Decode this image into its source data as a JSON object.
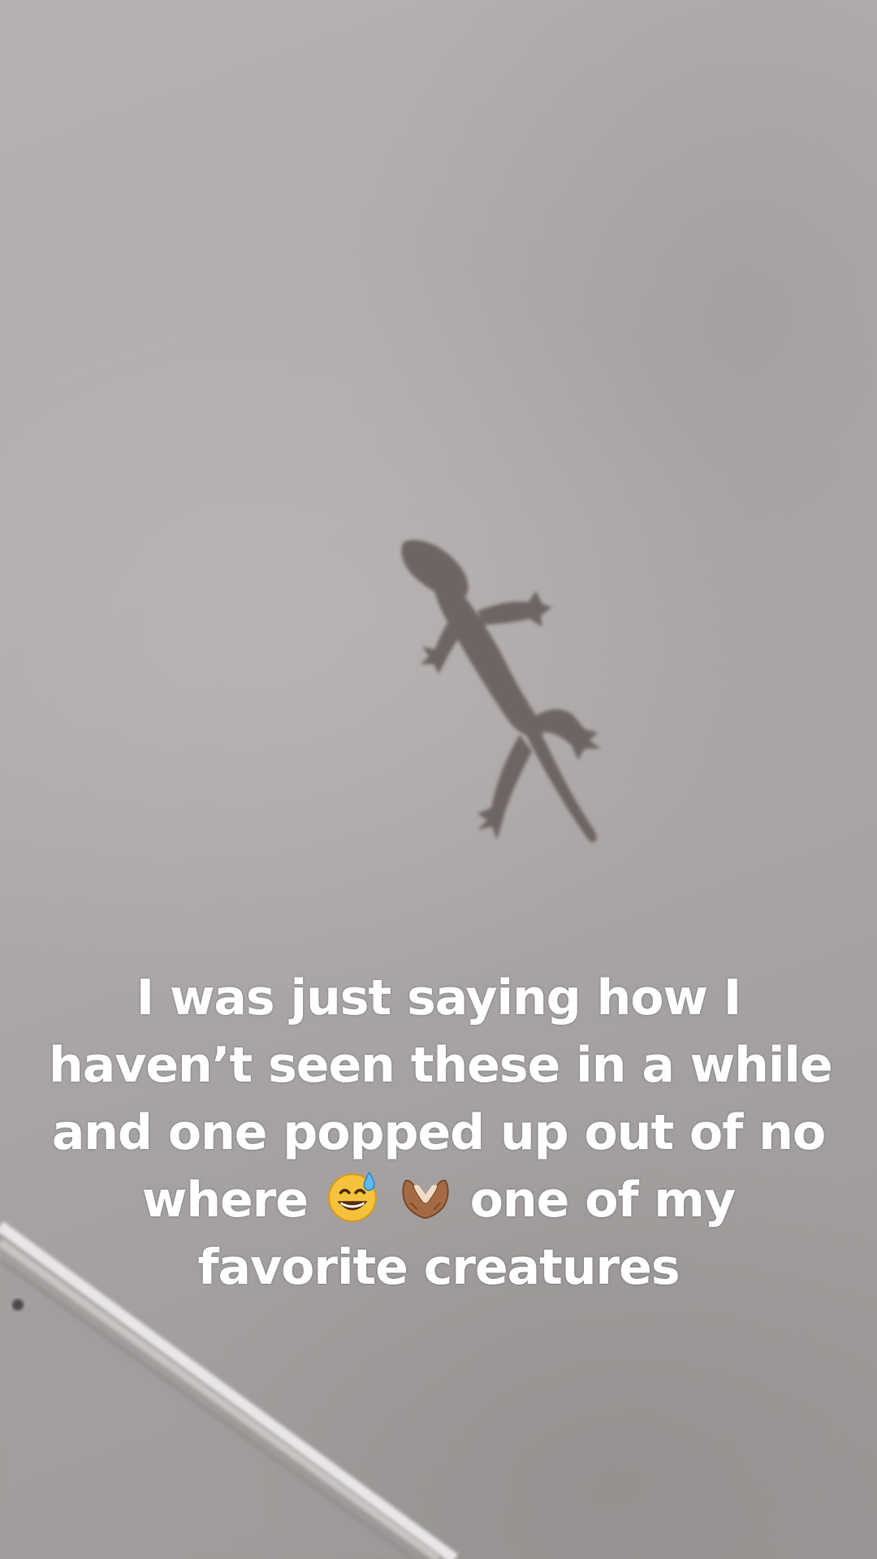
{
  "caption": {
    "line1": "I was just saying how I",
    "line2": "haven’t seen these in a while",
    "line3": "and one popped up out of no",
    "line4_before": "where",
    "line4_after": "one of my",
    "line5": "favorite creatures"
  },
  "emojis": [
    "grinning-face-with-sweat",
    "heart-hands-medium-dark-skin"
  ],
  "colors": {
    "ceiling": "#aeabaa",
    "gecko": "#6e6564",
    "caption_text": "#ffffff"
  }
}
